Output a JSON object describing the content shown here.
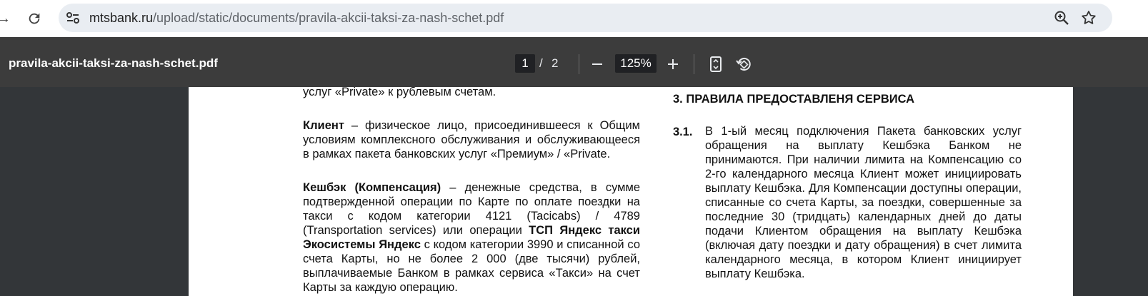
{
  "address_bar": {
    "url_host": "mtsbank.ru",
    "url_path": "/upload/static/documents/pravila-akcii-taksi-za-nash-schet.pdf"
  },
  "pdf_toolbar": {
    "filename": "pravila-akcii-taksi-za-nash-schet.pdf",
    "current_page": "1",
    "page_separator": "/",
    "total_pages": "2",
    "zoom": "125%"
  },
  "document": {
    "left_top_line": "услуг «Private» к рублевым счетам.",
    "client_term": "Клиент",
    "client_def": " – физическое лицо, присоединившееся к Общим условиям комплексного обслуживания и обслуживающееся в рамках пакета банковских услуг «Премиум» / «Private.",
    "cashback_term": "Кешбэк (Компенсация)",
    "cashback_def_1": " – денежные средства, в сумме подтвержденной операции по Карте по оплате поездки на такси с кодом категории 4121 (Tacicabs) / 4789 (Transportation services) или операции ",
    "cashback_bold": "ТСП Яндекс такси Экосистемы Яндекс",
    "cashback_def_2": " с кодом категории 3990 и списанной со счета Карты, но не более 2 000 (две тысячи) рублей, выплачиваемые Банком в рамках сервиса «Такси» на счет Карты за каждую операцию.",
    "section_title": "3.  ПРАВИЛА ПРЕДОСТАВЛЕНЯ СЕРВИСА",
    "item_number": "3.1.",
    "item_text": "В 1-ый месяц подключения Пакета банковских услуг обращения на выплату Кешбэка Банком не принимаются. При наличии лимита на Компенсацию со 2-го календарного месяца Клиент может инициировать выплату Кешбэка. Для Компенсации доступны операции, списанные со счета Карты, за  поездки, совершенные за последние 30 (тридцать) календарных дней до даты подачи Клиентом обращения на выплату Кешбэка (включая дату поездки и дату обращения) в счет лимита календарного месяца, в котором Клиент инициирует выплату Кешбэка."
  },
  "icons": {
    "back": "arrow-right-icon",
    "reload": "reload-icon",
    "site_info": "tune-icon",
    "zoom": "zoom-in-icon",
    "bookmark": "star-icon",
    "zoom_out": "minus-icon",
    "zoom_in": "plus-icon",
    "fit": "fit-page-icon",
    "rotate": "rotate-icon"
  }
}
